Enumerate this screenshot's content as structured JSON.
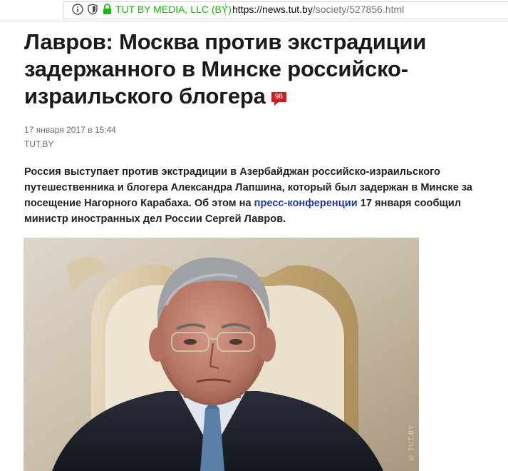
{
  "browser": {
    "org_name": "TUT BY MEDIA, LLC (BY)",
    "url_domain": "https://news.tut.by",
    "url_path": "/society/527856.html",
    "colors": {
      "secure_green": "#12bc00"
    },
    "icons": [
      "info-icon",
      "tracking-shield-icon",
      "lock-icon"
    ]
  },
  "article": {
    "title": "Лавров: Москва против экстрадиции задержанного в Минске российско-израильского блогера",
    "comment_count": "98",
    "date": "17 января 2017 в 15:44",
    "source": "TUT.BY",
    "lead_before": "Россия выступает против экстрадиции в Азербайджан российско-израильского путешественника и блогера Александра Лапшина, который был задержан в Минске за посещение Нагорного Карабаха. Об этом на ",
    "lead_link": "пресс-конференции",
    "lead_after": " 17 января сообщил министр иностранных дел России Сергей Лавров.",
    "colors": {
      "comment_badge": "#d01f1f",
      "link": "#21399f"
    }
  }
}
